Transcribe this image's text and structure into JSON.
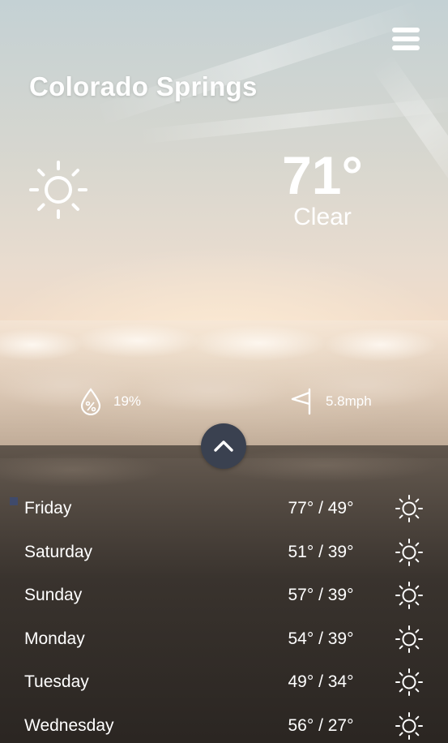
{
  "location": {
    "city": "Colorado Springs"
  },
  "current": {
    "temperature": "71°",
    "condition": "Clear",
    "icon": "sun-icon",
    "humidity": "19%",
    "wind": "5.8mph"
  },
  "menu": {
    "icon": "hamburger-menu-icon"
  },
  "toggle": {
    "icon": "chevron-up-icon"
  },
  "forecast": [
    {
      "day": "Friday",
      "range": "77° / 49°",
      "icon": "sun-icon"
    },
    {
      "day": "Saturday",
      "range": "51° / 39°",
      "icon": "sun-icon"
    },
    {
      "day": "Sunday",
      "range": "57° / 39°",
      "icon": "sun-icon"
    },
    {
      "day": "Monday",
      "range": "54° / 39°",
      "icon": "sun-icon"
    },
    {
      "day": "Tuesday",
      "range": "49° / 34°",
      "icon": "sun-icon"
    },
    {
      "day": "Wednesday",
      "range": "56° / 27°",
      "icon": "sun-icon"
    }
  ],
  "colors": {
    "toggle_bg": "#3a4150",
    "text": "#ffffff"
  }
}
